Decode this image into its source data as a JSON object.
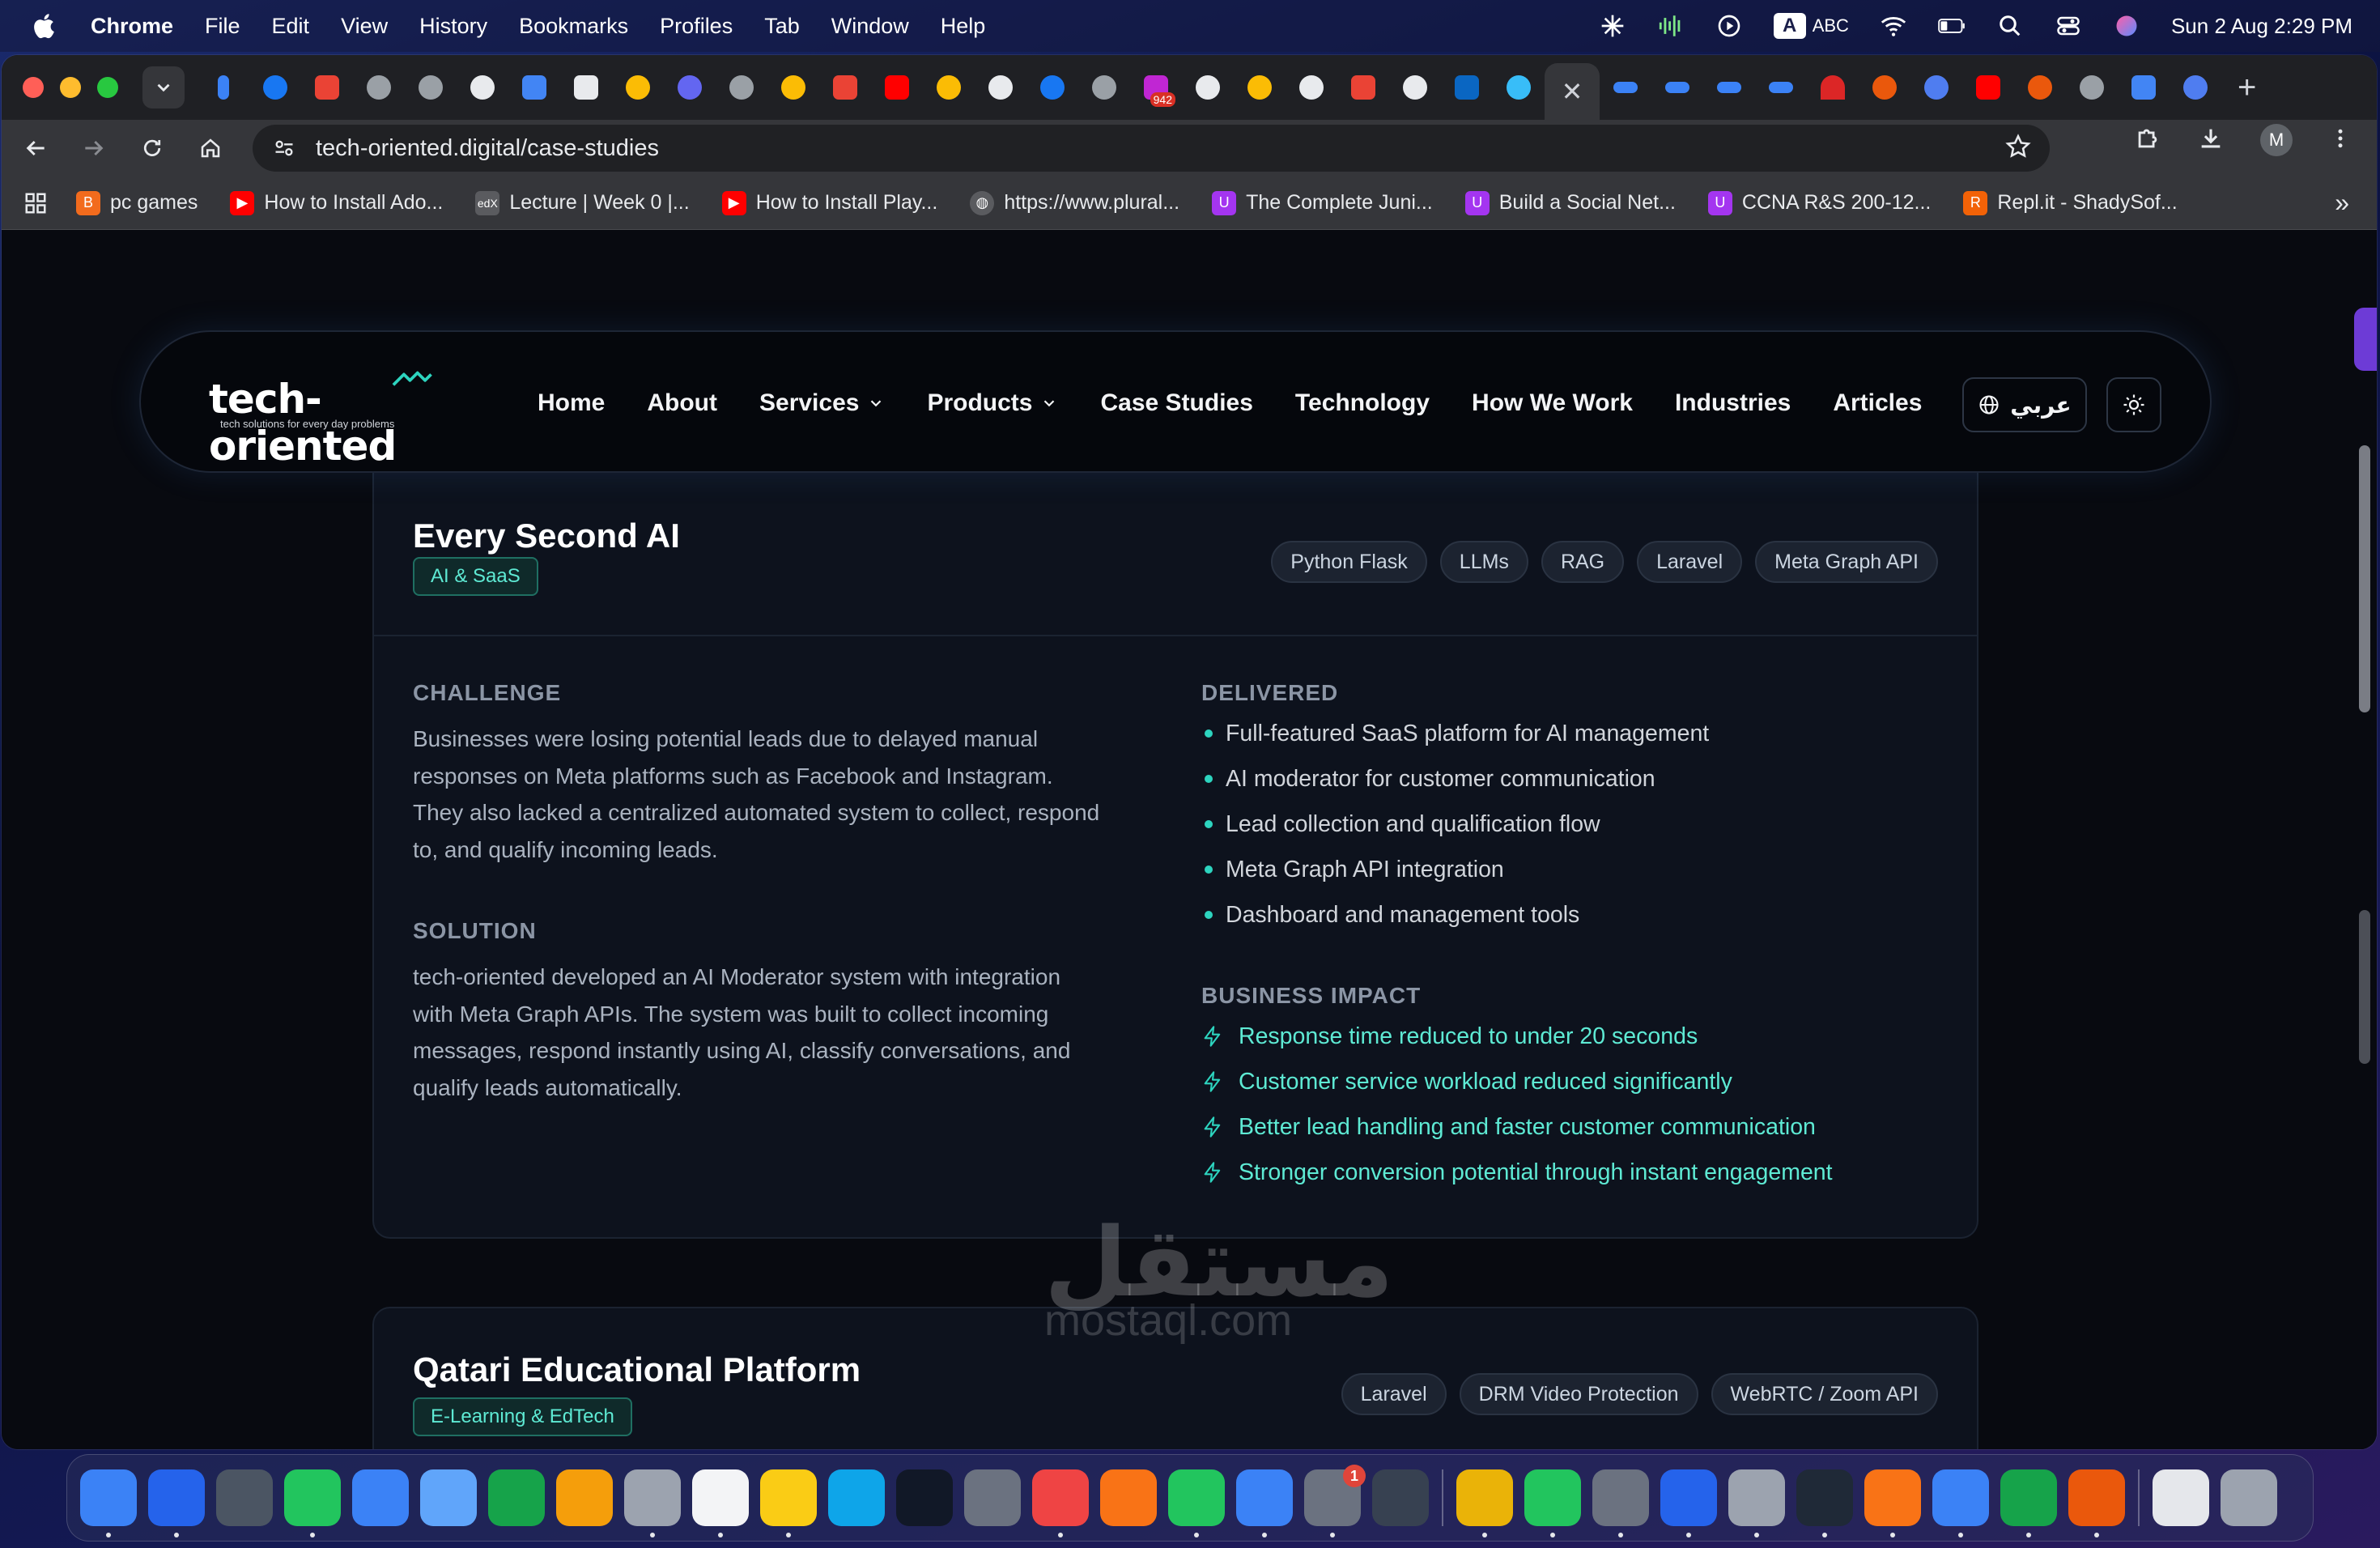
{
  "menubar": {
    "app_name": "Chrome",
    "menus": [
      "File",
      "Edit",
      "View",
      "History",
      "Bookmarks",
      "Profiles",
      "Tab",
      "Window",
      "Help"
    ],
    "input_source": "ABC",
    "input_badge": "A",
    "clock": "Sun 2 Aug  2:29 PM"
  },
  "browser": {
    "url": "tech-oriented.digital/case-studies",
    "profile_initial": "M",
    "tab_badge": "942",
    "bookmarks": [
      {
        "label": "pc games",
        "icon": "blogger-icon",
        "color": "#f26b1d"
      },
      {
        "label": "How to Install Ado...",
        "icon": "youtube-icon",
        "color": "#ff0000"
      },
      {
        "label": "Lecture | Week 0 |...",
        "icon": "edx-icon",
        "color": "#5a5b5f"
      },
      {
        "label": "How to Install Play...",
        "icon": "youtube-icon",
        "color": "#ff0000"
      },
      {
        "label": "https://www.plural...",
        "icon": "globe-icon",
        "color": "#5a5b5f"
      },
      {
        "label": "The Complete Juni...",
        "icon": "udemy-icon",
        "color": "#a435f0"
      },
      {
        "label": "Build a Social Net...",
        "icon": "udemy-icon",
        "color": "#a435f0"
      },
      {
        "label": "CCNA R&S 200-12...",
        "icon": "udemy-icon",
        "color": "#a435f0"
      },
      {
        "label": "Repl.it - ShadySof...",
        "icon": "replit-icon",
        "color": "#f26207"
      }
    ]
  },
  "site": {
    "brand": "tech-oriented",
    "tagline": "tech solutions for every day problems",
    "nav": [
      {
        "label": "Home",
        "dropdown": false
      },
      {
        "label": "About",
        "dropdown": false
      },
      {
        "label": "Services",
        "dropdown": true
      },
      {
        "label": "Products",
        "dropdown": true
      },
      {
        "label": "Case Studies",
        "dropdown": false
      },
      {
        "label": "Technology",
        "dropdown": false
      },
      {
        "label": "How We Work",
        "dropdown": false
      },
      {
        "label": "Industries",
        "dropdown": false
      },
      {
        "label": "Articles",
        "dropdown": false
      }
    ],
    "language_toggle": "عربي",
    "accent_color": "#2dd4bf"
  },
  "case_studies": [
    {
      "title": "Every Second AI",
      "category": "AI & SaaS",
      "tags": [
        "Python Flask",
        "LLMs",
        "RAG",
        "Laravel",
        "Meta Graph API"
      ],
      "challenge_label": "CHALLENGE",
      "challenge_lines": [
        "Businesses were losing potential leads due to delayed manual",
        "responses on Meta platforms such as Facebook and Instagram.",
        "They also lacked a centralized automated system to collect, respond",
        "to, and qualify incoming leads."
      ],
      "solution_label": "SOLUTION",
      "solution_lines": [
        "tech-oriented developed an AI Moderator system with integration",
        "with Meta Graph APIs. The system was built to collect incoming",
        "messages, respond instantly using AI, classify conversations, and",
        "qualify leads automatically."
      ],
      "delivered_label": "DELIVERED",
      "delivered": [
        "Full-featured SaaS platform for AI management",
        "AI moderator for customer communication",
        "Lead collection and qualification flow",
        "Meta Graph API integration",
        "Dashboard and management tools"
      ],
      "impact_label": "BUSINESS IMPACT",
      "impact": [
        "Response time reduced to under 20 seconds",
        "Customer service workload reduced significantly",
        "Better lead handling and faster customer communication",
        "Stronger conversion potential through instant engagement"
      ]
    },
    {
      "title": "Qatari Educational Platform",
      "category": "E-Learning & EdTech",
      "tags": [
        "Laravel",
        "DRM Video Protection",
        "WebRTC / Zoom API"
      ]
    }
  ],
  "watermark": {
    "text": "مستقل",
    "sub": "mostaql.com"
  },
  "dock": {
    "settings_badge": "1",
    "apps": [
      {
        "name": "finder",
        "color": "#3b82f6"
      },
      {
        "name": "safari",
        "color": "#2563eb"
      },
      {
        "name": "launchpad",
        "color": "#4b5563"
      },
      {
        "name": "messages",
        "color": "#22c55e"
      },
      {
        "name": "mail",
        "color": "#3b82f6"
      },
      {
        "name": "maps",
        "color": "#60a5fa"
      },
      {
        "name": "facetime",
        "color": "#16a34a"
      },
      {
        "name": "photos",
        "color": "#f59e0b"
      },
      {
        "name": "contacts",
        "color": "#9ca3af"
      },
      {
        "name": "reminders",
        "color": "#f3f4f6"
      },
      {
        "name": "notes",
        "color": "#facc15"
      },
      {
        "name": "freeform",
        "color": "#0ea5e9"
      },
      {
        "name": "apple-tv",
        "color": "#111827"
      },
      {
        "name": "tips",
        "color": "#6b7280"
      },
      {
        "name": "music",
        "color": "#ef4444"
      },
      {
        "name": "pages",
        "color": "#f97316"
      },
      {
        "name": "numbers",
        "color": "#22c55e"
      },
      {
        "name": "app-store",
        "color": "#3b82f6"
      },
      {
        "name": "system-settings",
        "color": "#6b7280"
      },
      {
        "name": "screenshot-app",
        "color": "#374151"
      },
      {
        "name": "chrome",
        "color": "#eab308"
      },
      {
        "name": "whatsapp",
        "color": "#22c55e"
      },
      {
        "name": "calculator",
        "color": "#6b7280"
      },
      {
        "name": "vscode",
        "color": "#2563eb"
      },
      {
        "name": "disk-utility",
        "color": "#9ca3af"
      },
      {
        "name": "terminal",
        "color": "#1f2937"
      },
      {
        "name": "zoom-recorder",
        "color": "#f97316"
      },
      {
        "name": "xcode-instruments",
        "color": "#3b82f6"
      },
      {
        "name": "audio-app",
        "color": "#16a34a"
      },
      {
        "name": "claude",
        "color": "#ea580c"
      },
      {
        "name": "documents",
        "color": "#e5e7eb"
      },
      {
        "name": "trash",
        "color": "#9ca3af"
      }
    ]
  }
}
